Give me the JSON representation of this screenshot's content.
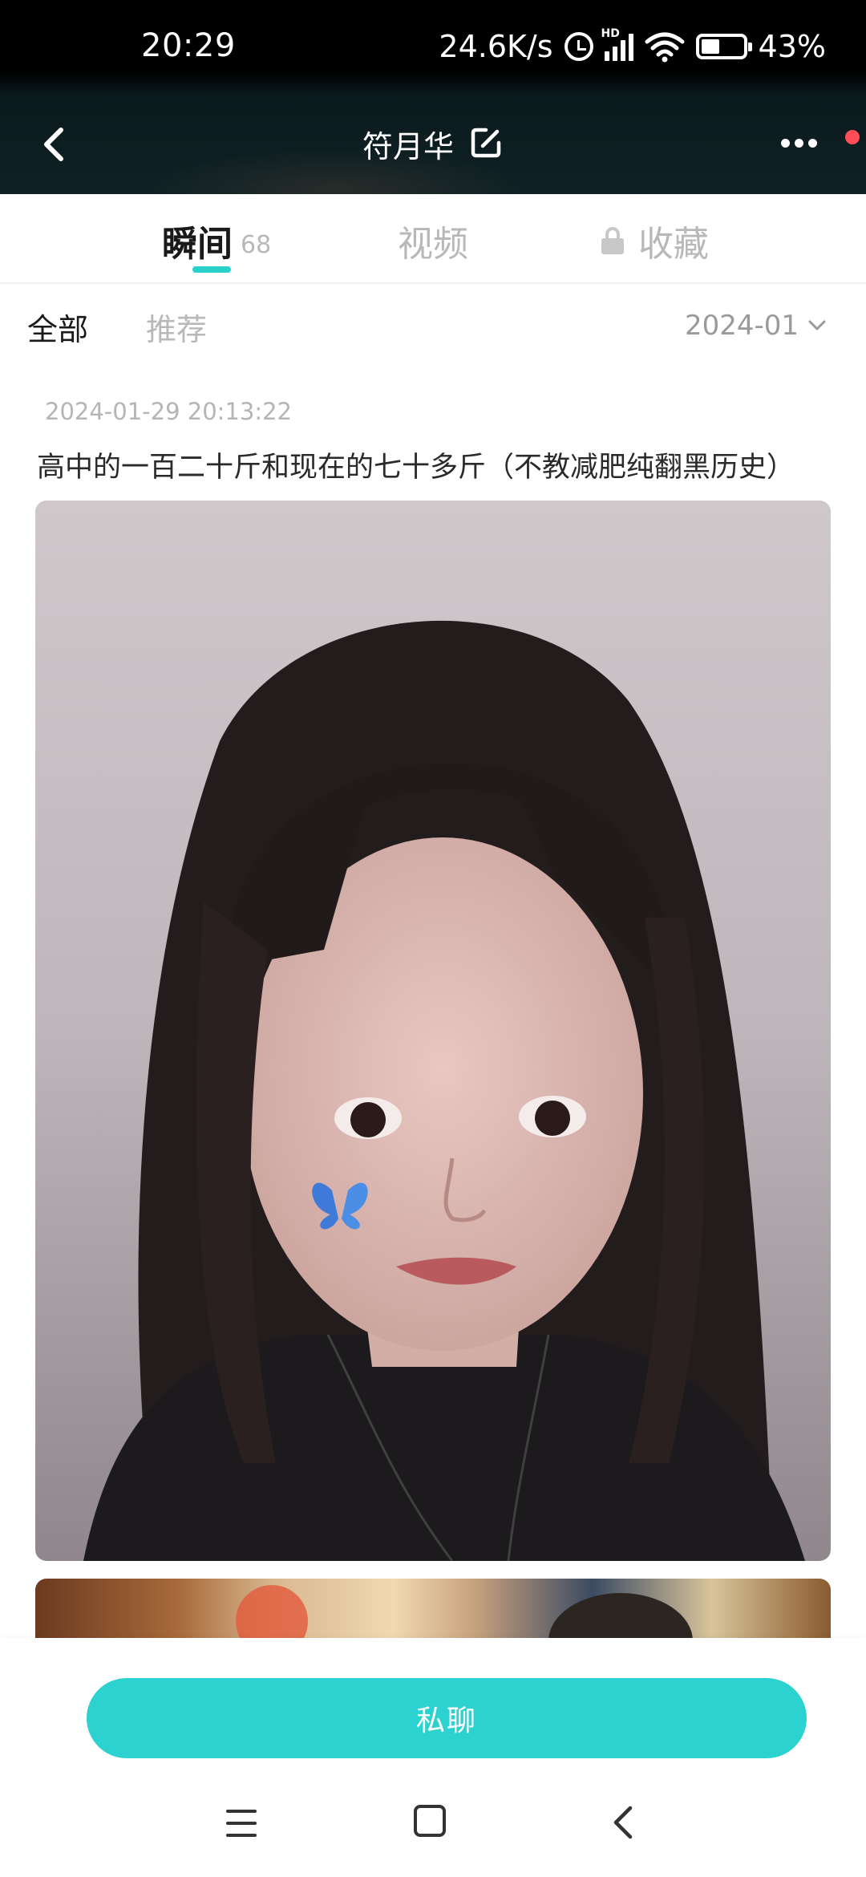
{
  "status_bar": {
    "time": "20:29",
    "net_speed": "24.6K/s",
    "signal_badge": "HD",
    "battery_pct": "43%",
    "battery_level": 0.43
  },
  "header": {
    "title": "符月华",
    "back_icon": "chevron-left-icon",
    "edit_icon": "edit-icon",
    "more_icon": "more-horizontal-icon",
    "notify_color": "#ff4d5a"
  },
  "tabs": [
    {
      "label": "瞬间",
      "count": "68",
      "active": true
    },
    {
      "label": "视频",
      "active": false
    },
    {
      "label": "收藏",
      "locked": true,
      "active": false
    }
  ],
  "filters": {
    "all": "全部",
    "recommend": "推荐",
    "date": "2024-01"
  },
  "post": {
    "timestamp": "2024-01-29 20:13:22",
    "text": "高中的一百二十斤和现在的七十多斤（不教减肥纯翻黑历史）"
  },
  "actions": {
    "private_chat": "私聊"
  },
  "colors": {
    "accent": "#2bd2cf",
    "header_bg": "#0f2125"
  }
}
